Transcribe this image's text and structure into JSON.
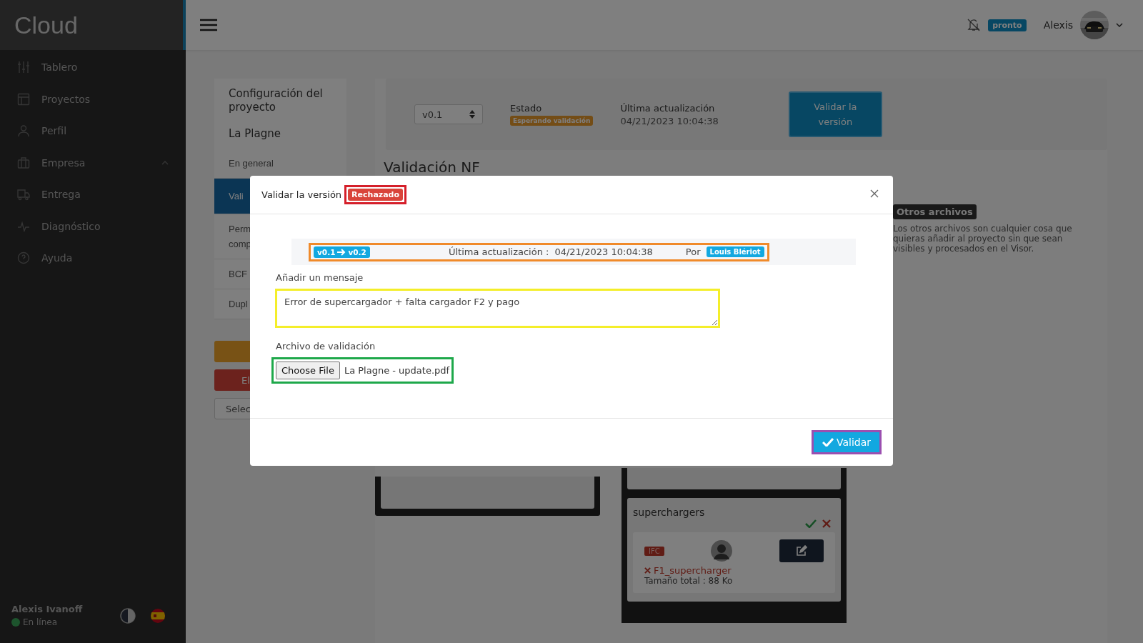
{
  "sidebar": {
    "logo": "Cloud",
    "items": [
      {
        "label": "Tablero",
        "kind": "link"
      },
      {
        "label": "Proyectos",
        "kind": "link"
      },
      {
        "label": "Perfil",
        "kind": "link"
      },
      {
        "label": "Empresa",
        "kind": "group",
        "expanded": true
      },
      {
        "label": "Entrega",
        "kind": "link"
      },
      {
        "label": "Diagnóstico",
        "kind": "link"
      },
      {
        "label": "Ayuda",
        "kind": "link"
      }
    ],
    "user": {
      "name": "Alexis Ivanoff",
      "status": "En línea",
      "online": true
    }
  },
  "header": {
    "notifications_badge": "pronto",
    "user_name": "Alexis"
  },
  "project_panel": {
    "title": "Configuración del proyecto",
    "project": "La Plagne",
    "items": [
      {
        "lines": [
          "En general"
        ],
        "selected": false
      },
      {
        "lines": [
          "Vali"
        ],
        "selected": true
      },
      {
        "lines": [
          "Perm",
          "comp"
        ],
        "selected": false
      },
      {
        "lines": [
          "BCF"
        ],
        "selected": false
      },
      {
        "lines": [
          "Dupl"
        ],
        "selected": false
      }
    ],
    "delete_button": "El",
    "select_placeholder": "Selec"
  },
  "version_bar": {
    "version": "v0.1",
    "status_label": "Estado",
    "status_badge": "Esperando validación",
    "updated_label": "Última actualización",
    "updated_value": "04/21/2023 10:04:38",
    "validate_button": "Validar la versión"
  },
  "section_title": "Validación NF",
  "other_files": {
    "tag": "Otros archivos",
    "text": "Los otros archivos son cualquier cosa que quieras añadir al proyecto sin que sean visibles y procesados en el Visor."
  },
  "file_card": {
    "title": "superchargers",
    "format_tag": "IFC",
    "file_name": "F1_supercharger",
    "size": "Tamaño total : 88 Ko"
  },
  "modal": {
    "title": "Validar la versión",
    "status_badge": "Rechazado",
    "version_from": "v0.1",
    "version_to": "v0.2",
    "updated_label": "Última actualización :",
    "updated_value": "04/21/2023 10:04:38",
    "by_label": "Por",
    "author": "Louis Blériot",
    "message_label": "Añadir un mensaje",
    "message_value": "Error de supercargador + falta cargador F2 y pago",
    "file_label": "Archivo de validación",
    "file_button": "Choose File",
    "file_name": "La Plagne - update.pdf",
    "submit": "Validar"
  }
}
